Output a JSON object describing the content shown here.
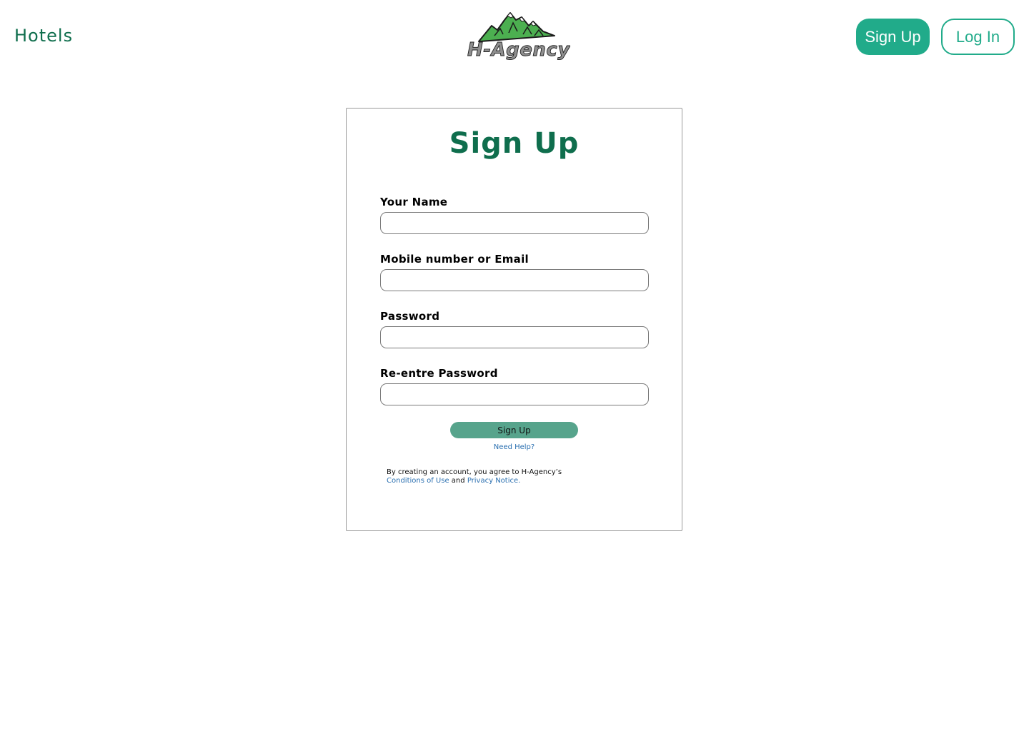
{
  "header": {
    "nav_hotels": "Hotels",
    "logo_text": "H-Agency",
    "signup_label": "Sign Up",
    "login_label": "Log In"
  },
  "form": {
    "title": "Sign Up",
    "fields": [
      {
        "label": "Your Name",
        "value": ""
      },
      {
        "label": "Mobile number or Email",
        "value": ""
      },
      {
        "label": "Password",
        "value": ""
      },
      {
        "label": "Re-entre Password",
        "value": ""
      }
    ],
    "submit_label": "Sign Up",
    "help_link": "Need Help?",
    "legal": {
      "prefix": "By creating an account, you agree to H-Agency’s",
      "conditions_link": "Conditions of Use",
      "conjunction": "and",
      "privacy_link": "Privacy Notice."
    }
  },
  "colors": {
    "brand_dark_green": "#0f6e4d",
    "accent_teal": "#21ab8a",
    "submit_green": "#57a48c",
    "link_blue": "#2a6fb0",
    "mountain_green": "#4caf50"
  },
  "icons": {
    "logo": "mountain-logo-icon"
  }
}
